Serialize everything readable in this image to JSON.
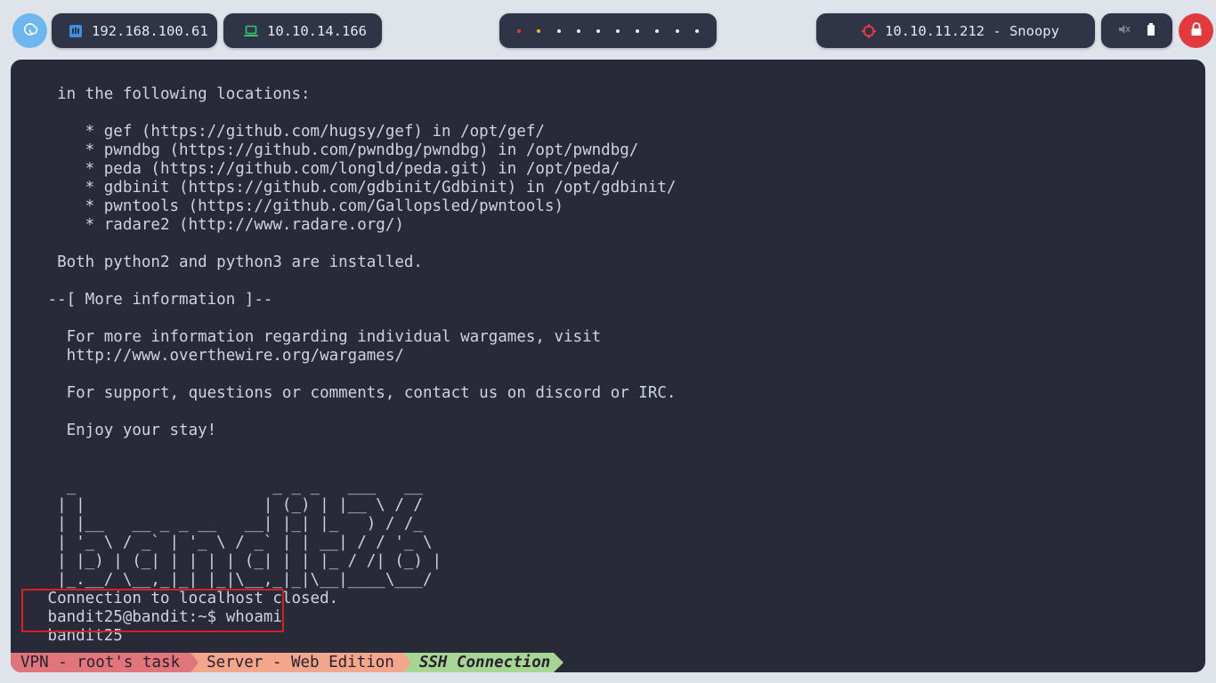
{
  "topbar": {
    "ip_local": "192.168.100.61",
    "ip_vpn": "10.10.14.166",
    "target": "10.10.11.212 - Snoopy",
    "dot_colors": [
      "#e2393f",
      "#f0b23a",
      "#e8eaf2",
      "#e8eaf2",
      "#e8eaf2",
      "#e8eaf2",
      "#e8eaf2",
      "#e8eaf2",
      "#e8eaf2",
      "#e8eaf2"
    ],
    "icons": {
      "launcher": "debian-swirl-icon",
      "local": "network-icon",
      "vpn": "laptop-icon",
      "target": "crosshair-icon",
      "mute": "speaker-muted-icon",
      "battery": "battery-icon",
      "lock": "lock-icon"
    }
  },
  "terminal": {
    "lines": [
      "  in the following locations:",
      "",
      "     * gef (https://github.com/hugsy/gef) in /opt/gef/",
      "     * pwndbg (https://github.com/pwndbg/pwndbg) in /opt/pwndbg/",
      "     * peda (https://github.com/longld/peda.git) in /opt/peda/",
      "     * gdbinit (https://github.com/gdbinit/Gdbinit) in /opt/gdbinit/",
      "     * pwntools (https://github.com/Gallopsled/pwntools)",
      "     * radare2 (http://www.radare.org/)",
      "",
      "  Both python2 and python3 are installed.",
      "",
      " --[ More information ]--",
      "",
      "   For more information regarding individual wargames, visit",
      "   http://www.overthewire.org/wargames/",
      "",
      "   For support, questions or comments, contact us on discord or IRC.",
      "",
      "   Enjoy your stay!",
      "",
      "",
      "   _                     _ _ _   ___   __",
      "  | |                   | (_) | |__ \\ / /",
      "  | |__   __ _ _ __   __| |_| |_   ) / /_",
      "  | '_ \\ / _` | '_ \\ / _` | | __| / / '_ \\",
      "  | |_) | (_| | | | | (_| | | |_ / /| (_) |",
      "  |_.__/ \\__,_|_| |_|\\__,_|_|\\__|____\\___/",
      " Connection to localhost closed.",
      " bandit25@bandit:~$ whoami",
      " bandit25"
    ]
  },
  "statusline": {
    "seg1": "VPN - root's task",
    "seg2": "Server - Web Edition",
    "seg3": "SSH Connection",
    "colors": {
      "seg1": "#e0767b",
      "seg2": "#f4a68c",
      "seg3": "#a6d693"
    }
  }
}
